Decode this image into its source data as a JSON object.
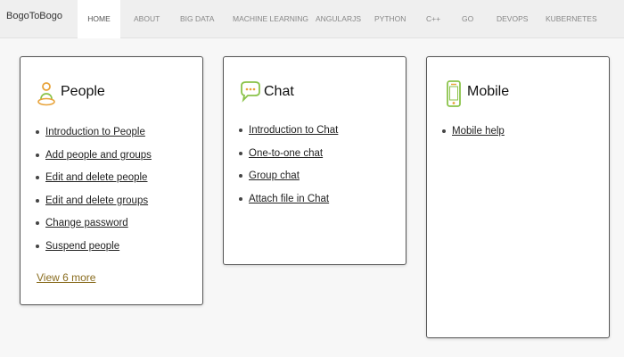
{
  "brand": "BogoToBogo",
  "nav": [
    "HOME",
    "ABOUT",
    "BIG DATA",
    "MACHINE LEARNING",
    "ANGULARJS",
    "PYTHON",
    "C++",
    "GO",
    "DEVOPS",
    "KUBERNETES"
  ],
  "cards": [
    {
      "title": "People",
      "icon": "person-icon",
      "links": [
        "Introduction to People",
        "Add people and groups",
        "Edit and delete people",
        "Edit and delete groups",
        "Change password",
        "Suspend people"
      ],
      "more": "View 6 more"
    },
    {
      "title": "Chat",
      "icon": "chat-bubble-icon",
      "links": [
        "Introduction to Chat",
        "One-to-one chat",
        "Group chat",
        "Attach file in Chat"
      ]
    },
    {
      "title": "Mobile",
      "icon": "mobile-phone-icon",
      "links": [
        "Mobile help"
      ]
    }
  ],
  "colors": {
    "icon_orange": "#e8a33a",
    "icon_green": "#8bc34a",
    "more_link": "#8a6d20"
  }
}
